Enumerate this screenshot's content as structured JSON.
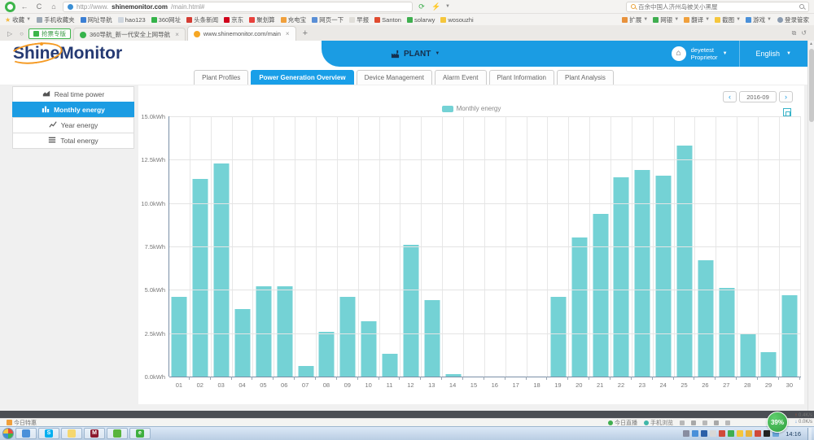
{
  "browser": {
    "url_prefix": "http://www.",
    "url_host": "shinemonitor.com",
    "url_path": "/main.html#",
    "search_text": "百余中国人济州岛被关小黑屋",
    "favorites_label": "收藏",
    "bookmarks": [
      {
        "label": "手机收藏夹",
        "color": "#9aa7b5"
      },
      {
        "label": "网址导航",
        "color": "#3b7fd4"
      },
      {
        "label": "hao123",
        "color": "#cfd6de"
      },
      {
        "label": "360网址",
        "color": "#35b34a"
      },
      {
        "label": "头条新闻",
        "color": "#d43c33"
      },
      {
        "label": "京东",
        "color": "#d0021b"
      },
      {
        "label": "聚划算",
        "color": "#e8413c"
      },
      {
        "label": "充电宝",
        "color": "#f0a03c"
      },
      {
        "label": "网页一下",
        "color": "#5a8fd6"
      },
      {
        "label": "早报",
        "color": "#e0ded9"
      },
      {
        "label": "Santon",
        "color": "#e04b2f"
      },
      {
        "label": "solarwy",
        "color": "#3faf4f"
      },
      {
        "label": "wosouzhi",
        "color": "#f5c63c"
      }
    ],
    "tools": [
      {
        "label": "扩展",
        "color": "#e8923c"
      },
      {
        "label": "网银",
        "color": "#3fae4f"
      },
      {
        "label": "翻译",
        "color": "#f0a03c"
      },
      {
        "label": "截图",
        "color": "#f5c63c"
      },
      {
        "label": "游戏",
        "color": "#4a90d9"
      }
    ],
    "login_label": "登录管家",
    "ticket_button": "抢票专版",
    "tabs": [
      {
        "title": "360导航_新一代安全上网导航",
        "favicon": "#35b34a",
        "active": false
      },
      {
        "title": "www.shinemonitor.com/main",
        "favicon": "#f5a623",
        "active": true
      }
    ],
    "status_left": "今日特惠",
    "status_items": [
      {
        "label": "今日直播",
        "color": "#3fae4f"
      },
      {
        "label": "手机浏览",
        "color": "#3fb6a8"
      }
    ],
    "speed_ball": "39%",
    "net_up": "0.4K/s",
    "net_down": "0.0K/s"
  },
  "app": {
    "logo_part1": "Shine",
    "logo_part2": "Monitor",
    "nav_plant": "PLANT",
    "user_name": "deyetest",
    "user_role": "Proprietor",
    "language": "English",
    "tabs": [
      "Plant Profiles",
      "Power Generation Overview",
      "Device Management",
      "Alarm Event",
      "Plant Information",
      "Plant Analysis"
    ],
    "active_tab_index": 1,
    "sidebar": [
      {
        "label": "Real time power",
        "icon": "area-chart",
        "active": false
      },
      {
        "label": "Monthly energy",
        "icon": "bar-chart",
        "active": true
      },
      {
        "label": "Year energy",
        "icon": "line-chart",
        "active": false
      },
      {
        "label": "Total energy",
        "icon": "list",
        "active": false
      }
    ],
    "date_value": "2016-09"
  },
  "chart_data": {
    "type": "bar",
    "title": "",
    "legend": "Monthly energy",
    "legend_position": "top",
    "grid": true,
    "unit": "kWh",
    "xlabel": "",
    "ylabel": "",
    "ylim": [
      0,
      15
    ],
    "y_ticks": [
      "15.0kWh",
      "12.5kWh",
      "10.0kWh",
      "7.5kWh",
      "5.0kWh",
      "2.5kWh",
      "0.0kWh"
    ],
    "categories": [
      "01",
      "02",
      "03",
      "04",
      "05",
      "06",
      "07",
      "08",
      "09",
      "10",
      "11",
      "12",
      "13",
      "14",
      "15",
      "16",
      "17",
      "18",
      "19",
      "20",
      "21",
      "22",
      "23",
      "24",
      "25",
      "26",
      "27",
      "28",
      "29",
      "30"
    ],
    "values": [
      4.6,
      11.4,
      12.3,
      3.9,
      5.2,
      5.2,
      0.6,
      2.6,
      4.6,
      3.2,
      1.3,
      7.6,
      4.4,
      0.15,
      0,
      0,
      0,
      0,
      4.6,
      8.0,
      9.4,
      11.5,
      11.9,
      11.6,
      13.3,
      6.7,
      5.1,
      2.5,
      1.4,
      4.7
    ],
    "bar_color": "#74d2d5"
  },
  "taskbar": {
    "clock": "14:16",
    "apps": [
      {
        "name": "user-app",
        "color": "#4a90d9",
        "glyph": ""
      },
      {
        "name": "skype",
        "color": "#00aff0",
        "glyph": "S"
      },
      {
        "name": "notes",
        "color": "#f5d76e",
        "glyph": ""
      },
      {
        "name": "m-app",
        "color": "#8b1a2f",
        "glyph": "M"
      },
      {
        "name": "frog-app",
        "color": "#58b43c",
        "glyph": ""
      },
      {
        "name": "browser-360",
        "color": "#3faf3f",
        "glyph": "e"
      }
    ],
    "tray_colors": [
      "#888da0",
      "#4a90d9",
      "#2b5fa8",
      "#d8d8d8",
      "#d04a3a",
      "#3fae4f",
      "#f5c63c",
      "#e8b33a",
      "#d04a3a",
      "#222",
      "#6aa5d8"
    ]
  }
}
